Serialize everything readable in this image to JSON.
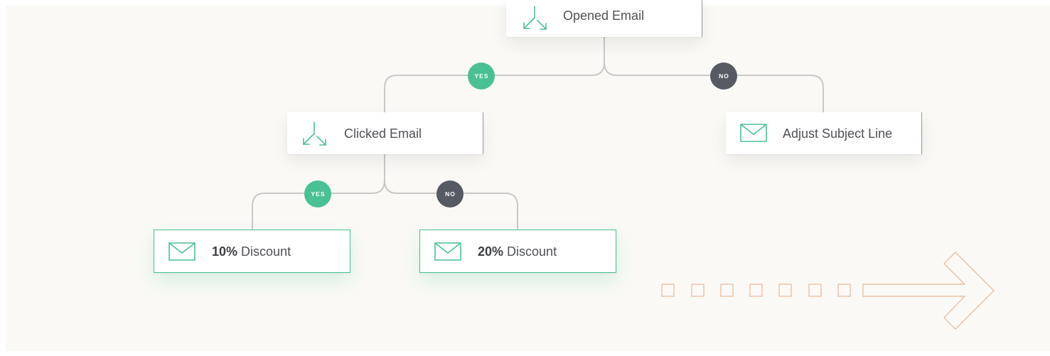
{
  "colors": {
    "background": "#faf9f6",
    "accent_green": "#49c192",
    "badge_dark": "#555a63",
    "connector": "#c8c8c8",
    "decor_orange": "#e8b99a"
  },
  "nodes": {
    "opened_email": {
      "label": "Opened Email",
      "icon": "split-icon"
    },
    "clicked_email": {
      "label": "Clicked Email",
      "icon": "split-icon"
    },
    "adjust_subject": {
      "label": "Adjust Subject Line",
      "icon": "envelope-icon"
    },
    "discount_10": {
      "value": "10%",
      "label": " Discount",
      "icon": "envelope-icon"
    },
    "discount_20": {
      "value": "20%",
      "label": " Discount",
      "icon": "envelope-icon"
    }
  },
  "badges": {
    "opened_yes": "YES",
    "opened_no": "NO",
    "clicked_yes": "YES",
    "clicked_no": "NO"
  },
  "decoration": {
    "icon": "dashed-arrow-icon"
  }
}
